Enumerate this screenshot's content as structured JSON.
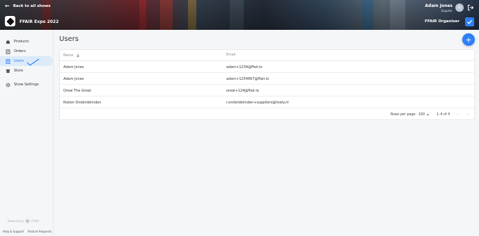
{
  "header": {
    "back_label": "Back to all shows",
    "event_title": "FFAIR Expo 2022",
    "user_name": "Adam Jones",
    "user_role": "Supplier",
    "avatar_initials": "AJ",
    "role_label": "FFAIR Organiser"
  },
  "sidebar": {
    "items": [
      {
        "label": "Products",
        "icon": "products-icon"
      },
      {
        "label": "Orders",
        "icon": "orders-icon"
      },
      {
        "label": "Users",
        "icon": "users-icon",
        "active": true
      },
      {
        "label": "Store",
        "icon": "store-icon"
      },
      {
        "label": "Show Settings",
        "icon": "gear-icon"
      }
    ],
    "powered_by": "Powered by",
    "powered_brand": "FFAIR",
    "footer": {
      "help": "Help & Support",
      "features": "Feature Requests"
    }
  },
  "main": {
    "title": "Users",
    "add_button": "+",
    "table": {
      "headers": [
        "Name",
        "Email"
      ],
      "rows": [
        {
          "name": "Adam Jones",
          "email": "adam+1234@ffair.io"
        },
        {
          "name": "Adam Jones",
          "email": "adam+1254667@ffair.io"
        },
        {
          "name": "Oreal The Great",
          "email": "oreal+124@ffair.io"
        },
        {
          "name": "Ruben Onderdelinden",
          "email": "r.onderdelinden+suppliers@lively.nl"
        }
      ]
    },
    "pagination": {
      "rows_per_page_label": "Rows per page:",
      "rows_per_page": "100",
      "range": "1–4 of 4"
    }
  },
  "colors": {
    "accent": "#2d7ff9",
    "active_nav_bg": "#dceaf9"
  }
}
